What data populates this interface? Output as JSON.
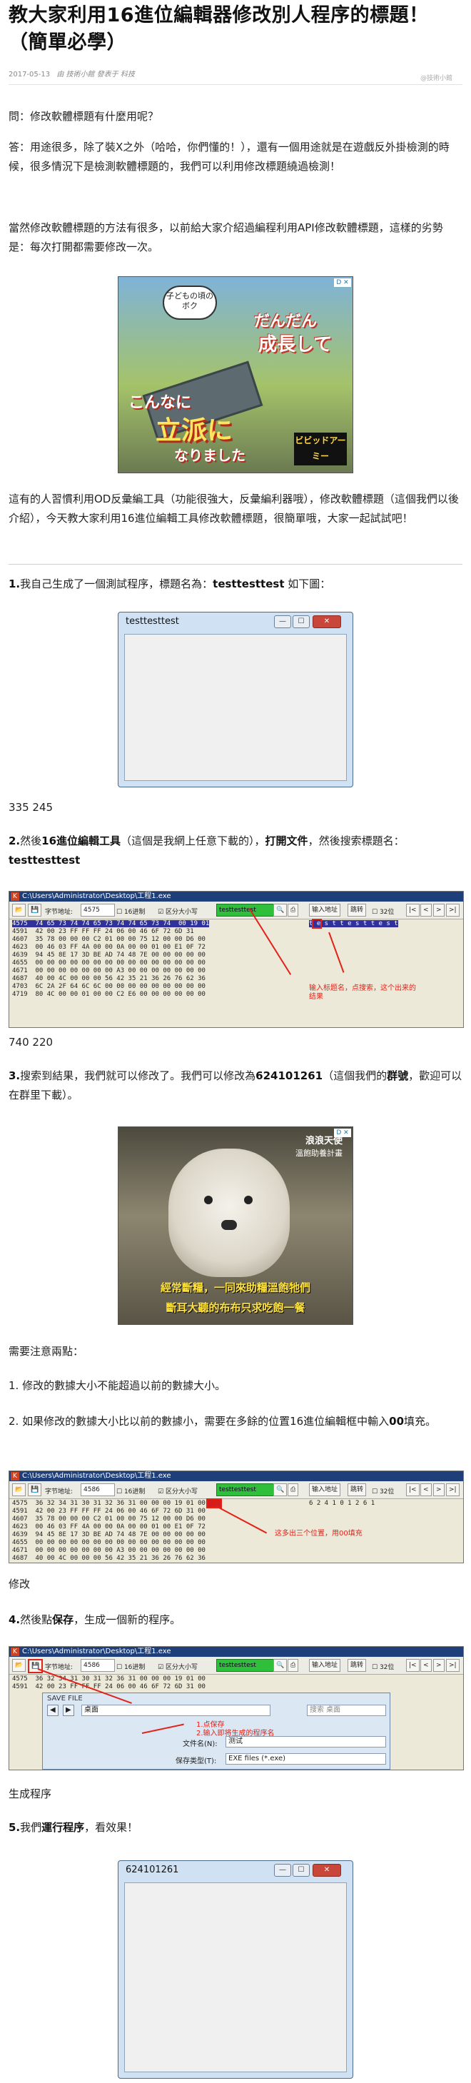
{
  "article": {
    "title": "教大家利用16進位編輯器修改別人程序的標題！（簡單必學）",
    "date": "2017-05-13",
    "author": "由 技術小館 發表于 科技"
  },
  "paragraphs": {
    "q": "問：修改軟體標題有什麼用呢？",
    "a1": "答：用途很多，除了裝X之外（哈哈，你們懂的！），還有一個用途就是在遊戲反外掛檢測的時候，很多情況下是檢測軟體標題的，我們可以利用修改標題繞過檢測！",
    "a2": "當然修改軟體標題的方法有很多，以前給大家介紹過編程利用API修改軟體標題，這樣的劣勢是：每次打開都需要修改一次。",
    "a3": "這有的人習慣利用OD反彙編工具（功能很強大，反彙編利器哦），修改軟體標題（這個我們以後介紹），今天教大家利用16進位編輯工具修改軟體標題，很簡單哦，大家一起試試吧！",
    "s1_prefix": "1.",
    "s1": "我自己生成了一個測試程序，標題名為：",
    "s1_bold": "testtesttest",
    "s1_suffix": " 如下圖：",
    "dims1": "335 245",
    "s2_prefix": "2.",
    "s2_a": "然後",
    "s2_b": "16進位編輯工具",
    "s2_c": "（這個是我網上任意下載的），",
    "s2_d": "打開文件",
    "s2_e": "，然後搜索標題名：",
    "s2_f": "testtesttest",
    "dims2": "740 220",
    "s3_prefix": "3.",
    "s3_a": "搜索到結果，我們就可以修改了。我們可以修改為",
    "s3_b": "624101261",
    "s3_c": "（這個我們的",
    "s3_d": "群號",
    "s3_e": "，歡迎可以在群里下載）。",
    "notes_head": "需要注意兩點：",
    "note1": "1. 修改的數據大小不能超過以前的數據大小。",
    "note2_a": "2. 如果修改的數據大小比以前的數據小，需要在多餘的位置16進位編輯框中輸入",
    "note2_b": "00",
    "note2_c": "填充。",
    "cap_modify": "修改",
    "s4_prefix": "4.",
    "s4_a": "然後點",
    "s4_b": "保存",
    "s4_c": "，生成一個新的程序。",
    "cap_gen": "生成程序",
    "s5_prefix": "5.",
    "s5_a": "我們",
    "s5_b": "運行程序",
    "s5_c": "，看效果！"
  },
  "ad1": {
    "badge": "D ✕",
    "bubble": "子どもの頃のボク",
    "l1": "だんだん",
    "l2": "成長して",
    "l3": "こんなに",
    "l4": "立派に",
    "l5": "なりました",
    "logo": "ビビッドアーミー"
  },
  "ad2": {
    "badge": "D ✕",
    "wm1": "浪浪天使",
    "wm2": "溫飽助養計畫",
    "cap1": "經常斷糧，一同來助糧溫飽牠們",
    "cap2": "斷耳大聽的布布只求吃飽一餐"
  },
  "win1": {
    "title": "testtesttest",
    "min": "—",
    "max": "☐",
    "close": "✕"
  },
  "win2": {
    "title": "624101261",
    "min": "—",
    "max": "☐",
    "close": "✕"
  },
  "hex1": {
    "title": "C:\\Users\\Administrator\\Desktop\\工程1.exe",
    "addr_label": "字节地址:",
    "addr_val": "4575",
    "hex_cb": "16进制",
    "case_cb": "区分大小写",
    "search_val": "testtesttest",
    "input_btn": "输入地址",
    "jump_btn": "跳转",
    "bit_cb": "32位",
    "sel_row": "4575  74 65 73 74 74 65 73 74 74 65 73 74  00 19 01",
    "rows": "4591  42 00 23 FF FF FF 24 06 00 46 6F 72 6D 31\n4607  35 78 00 00 00 C2 01 00 00 75 12 00 00 D6 00\n4623  00 46 03 FF 4A 00 00 0A 00 00 01 00 E1 0F 72\n4639  94 45 8E 17 3D BE AD 74 48 7E 00 00 00 00 00\n4655  00 00 00 00 00 00 00 00 00 00 00 00 00 00 00\n4671  00 00 00 00 00 00 00 A3 00 00 00 00 00 00 00\n4687  40 00 4C 00 00 00 56 42 35 21 36 26 76 62 36\n4703  6C 2A 2F 64 6C 6C 00 00 00 00 00 00 00 00 00\n4719  80 4C 00 00 01 00 00 C2 E6 00 00 00 00 00 00",
    "chars": "t e s t t e s t t e s t",
    "note": "输入标题名，点搜索，这个出来的结果"
  },
  "hex2": {
    "title": "C:\\Users\\Administrator\\Desktop\\工程1.exe",
    "addr_label": "字节地址:",
    "addr_val": "4586",
    "hex_cb": "16进制",
    "case_cb": "区分大小写",
    "search_val": "testtesttest",
    "input_btn": "输入地址",
    "jump_btn": "跳转",
    "bit_cb": "32位",
    "rows": "4575  36 32 34 31 30 31 32 36 31 00 00 00 19 01 00\n4591  42 00 23 FF FF FF 24 06 00 46 6F 72 6D 31 00\n4607  35 78 00 00 00 C2 01 00 00 75 12 00 00 D6 00\n4623  00 46 03 FF 4A 00 00 0A 00 00 01 00 E1 0F 72\n4639  94 45 8E 17 3D BE AD 74 48 7E 00 00 00 00 00\n4655  00 00 00 00 00 00 00 00 00 00 00 00 00 00 00\n4671  00 00 00 00 00 00 00 A3 00 00 00 00 00 00 00\n4687  40 00 4C 00 00 00 56 42 35 21 36 26 76 62 36\n4703  6C 2A 2F 64 6C 6C 00 00 00 00 00 00 00 00 00\n4719  80 4C 00 00 01 00 00 C2 E6 00 00 00 00 00 00",
    "chars": "6 2 4 1 0 1 2 6 1",
    "note": "这多出三个位置，用00填充"
  },
  "hex3": {
    "title": "C:\\Users\\Administrator\\Desktop\\工程1.exe",
    "addr_label": "字节地址:",
    "addr_val": "4586",
    "hex_cb": "16进制",
    "case_cb": "区分大小写",
    "search_val": "testtesttest",
    "input_btn": "输入地址",
    "jump_btn": "跳转",
    "bit_cb": "32位",
    "rows": "4575  36 32 34 31 30 31 32 36 31 00 00 00 19 01 00\n4591  42 00 23 FF FF FF 24 06 00 46 6F 72 6D 31 00",
    "save_title": "SAVE FILE",
    "path": "桌面",
    "search_ph": "搜索 桌面",
    "filename_label": "文件名(N):",
    "filename_val": "测试",
    "type_label": "保存类型(T):",
    "type_val": "EXE files (*.exe)",
    "note1": "1.点保存",
    "note2": "2.输入即将生成的程序名"
  },
  "footer": {
    "watermark": "@技術小館"
  },
  "colors": {
    "title_text": "#111111",
    "accent_red": "#e2231a",
    "hex_selection": "#30319a"
  }
}
